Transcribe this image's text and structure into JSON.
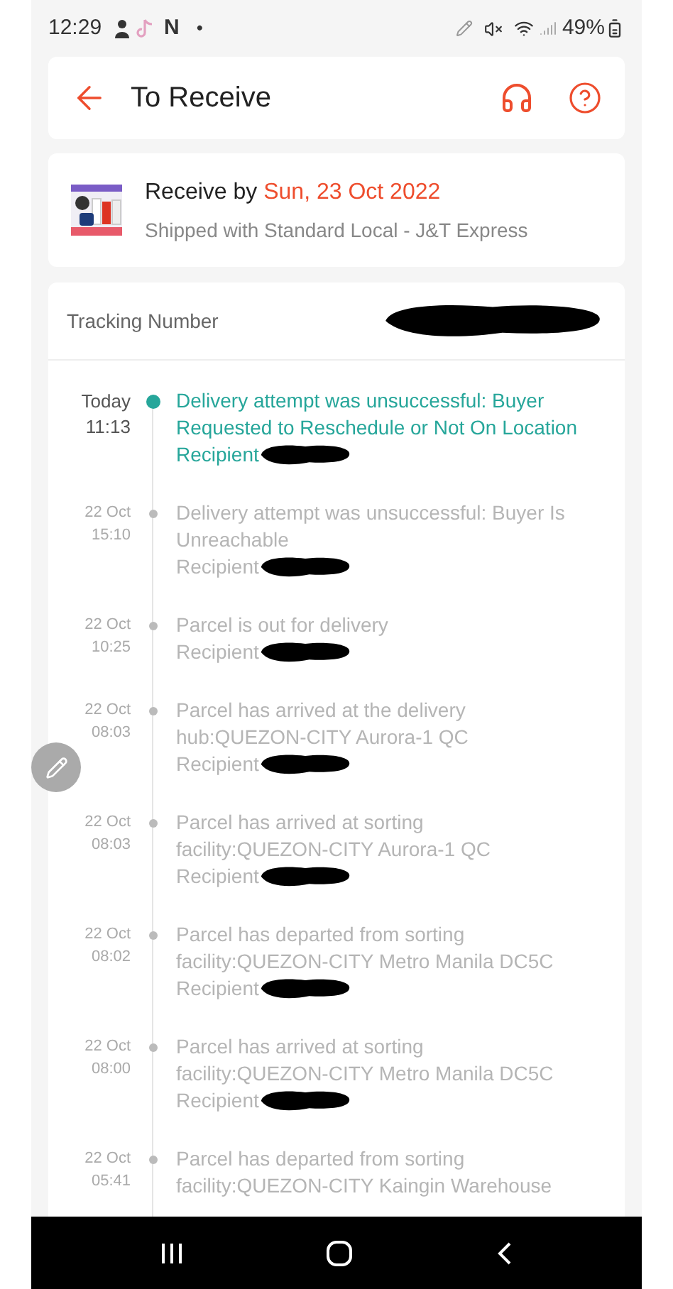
{
  "status_bar": {
    "time": "12:29",
    "app_letter": "N",
    "dot": "•",
    "battery": "49%"
  },
  "header": {
    "title": "To Receive"
  },
  "delivery": {
    "prefix": "Receive by",
    "date": "Sun, 23 Oct 2022",
    "shipping": "Shipped with Standard Local - J&T Express"
  },
  "tracking": {
    "label": "Tracking Number"
  },
  "events": [
    {
      "date": "Today",
      "time": "11:13",
      "text": "Delivery attempt was unsuccessful: Buyer Requested to Reschedule or Not On Location",
      "recipient": "Recipient",
      "selected": true
    },
    {
      "date": "22 Oct",
      "time": "15:10",
      "text": "Delivery attempt was unsuccessful: Buyer Is Unreachable",
      "recipient": "Recipient",
      "selected": false
    },
    {
      "date": "22 Oct",
      "time": "10:25",
      "text": "Parcel is out for delivery",
      "recipient": "Recipient",
      "selected": false
    },
    {
      "date": "22 Oct",
      "time": "08:03",
      "text": "Parcel has arrived at the delivery hub:QUEZON-CITY Aurora-1 QC",
      "recipient": "Recipient",
      "selected": false
    },
    {
      "date": "22 Oct",
      "time": "08:03",
      "text": "Parcel has arrived at sorting facility:QUEZON-CITY Aurora-1 QC",
      "recipient": "Recipient",
      "selected": false
    },
    {
      "date": "22 Oct",
      "time": "08:02",
      "text": "Parcel has departed from sorting facility:QUEZON-CITY Metro Manila DC5C",
      "recipient": "Recipient",
      "selected": false
    },
    {
      "date": "22 Oct",
      "time": "08:00",
      "text": "Parcel has arrived at sorting facility:QUEZON-CITY Metro Manila DC5C",
      "recipient": "Recipient",
      "selected": false
    },
    {
      "date": "22 Oct",
      "time": "05:41",
      "text": "Parcel has departed from sorting facility:QUEZON-CITY Kaingin Warehouse",
      "selected": false
    }
  ]
}
